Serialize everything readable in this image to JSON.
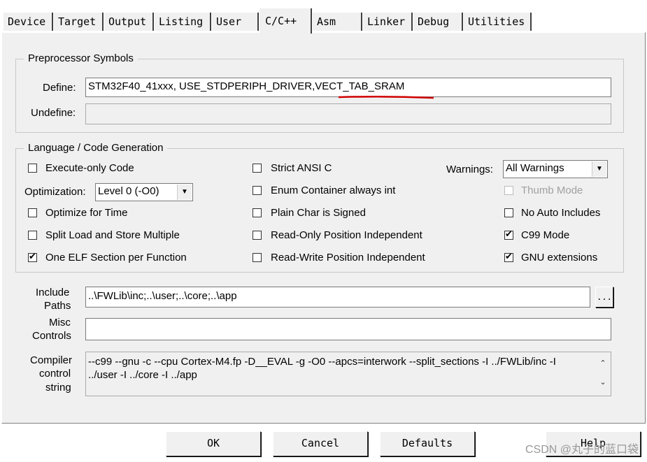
{
  "tabs": [
    "Device",
    "Target",
    "Output",
    "Listing",
    "User",
    "C/C++",
    "Asm",
    "Linker",
    "Debug",
    "Utilities"
  ],
  "preprocessor": {
    "legend": "Preprocessor Symbols",
    "define_label": "Define:",
    "define_value": "STM32F40_41xxx, USE_STDPERIPH_DRIVER,VECT_TAB_SRAM",
    "undefine_label": "Undefine:",
    "undefine_value": ""
  },
  "codegen": {
    "legend": "Language / Code Generation",
    "execute_only": {
      "label": "Execute-only Code",
      "checked": false
    },
    "optimization_label": "Optimization:",
    "optimization_value": "Level 0 (-O0)",
    "optimize_time": {
      "label": "Optimize for Time",
      "checked": false
    },
    "split_load": {
      "label": "Split Load and Store Multiple",
      "checked": false
    },
    "one_elf": {
      "label": "One ELF Section per Function",
      "checked": true
    },
    "strict_ansi": {
      "label": "Strict ANSI C",
      "checked": false
    },
    "enum_container": {
      "label": "Enum Container always int",
      "checked": false
    },
    "plain_char": {
      "label": "Plain Char is Signed",
      "checked": false
    },
    "ro_pi": {
      "label": "Read-Only Position Independent",
      "checked": false
    },
    "rw_pi": {
      "label": "Read-Write Position Independent",
      "checked": false
    },
    "warnings_label": "Warnings:",
    "warnings_value": "All Warnings",
    "thumb_mode": {
      "label": "Thumb Mode",
      "checked": false,
      "disabled": true
    },
    "no_auto_includes": {
      "label": "No Auto Includes",
      "checked": false
    },
    "c99_mode": {
      "label": "C99 Mode",
      "checked": true
    },
    "gnu_ext": {
      "label": "GNU extensions",
      "checked": true
    }
  },
  "include": {
    "label_line1": "Include",
    "label_line2": "Paths",
    "value": "..\\FWLib\\inc;..\\user;..\\core;..\\app",
    "browse": "..."
  },
  "misc": {
    "label_line1": "Misc",
    "label_line2": "Controls",
    "value": ""
  },
  "compiler": {
    "label_line1": "Compiler",
    "label_line2": "control",
    "label_line3": "string",
    "line1": "--c99 --gnu -c --cpu Cortex-M4.fp -D__EVAL -g -O0 --apcs=interwork --split_sections -I ../FWLib/inc -I",
    "line2": "../user -I ../core -I ../app"
  },
  "buttons": {
    "ok": "OK",
    "cancel": "Cancel",
    "defaults": "Defaults",
    "help": "Help"
  },
  "watermark": "CSDN @丸子的蓝口袋"
}
